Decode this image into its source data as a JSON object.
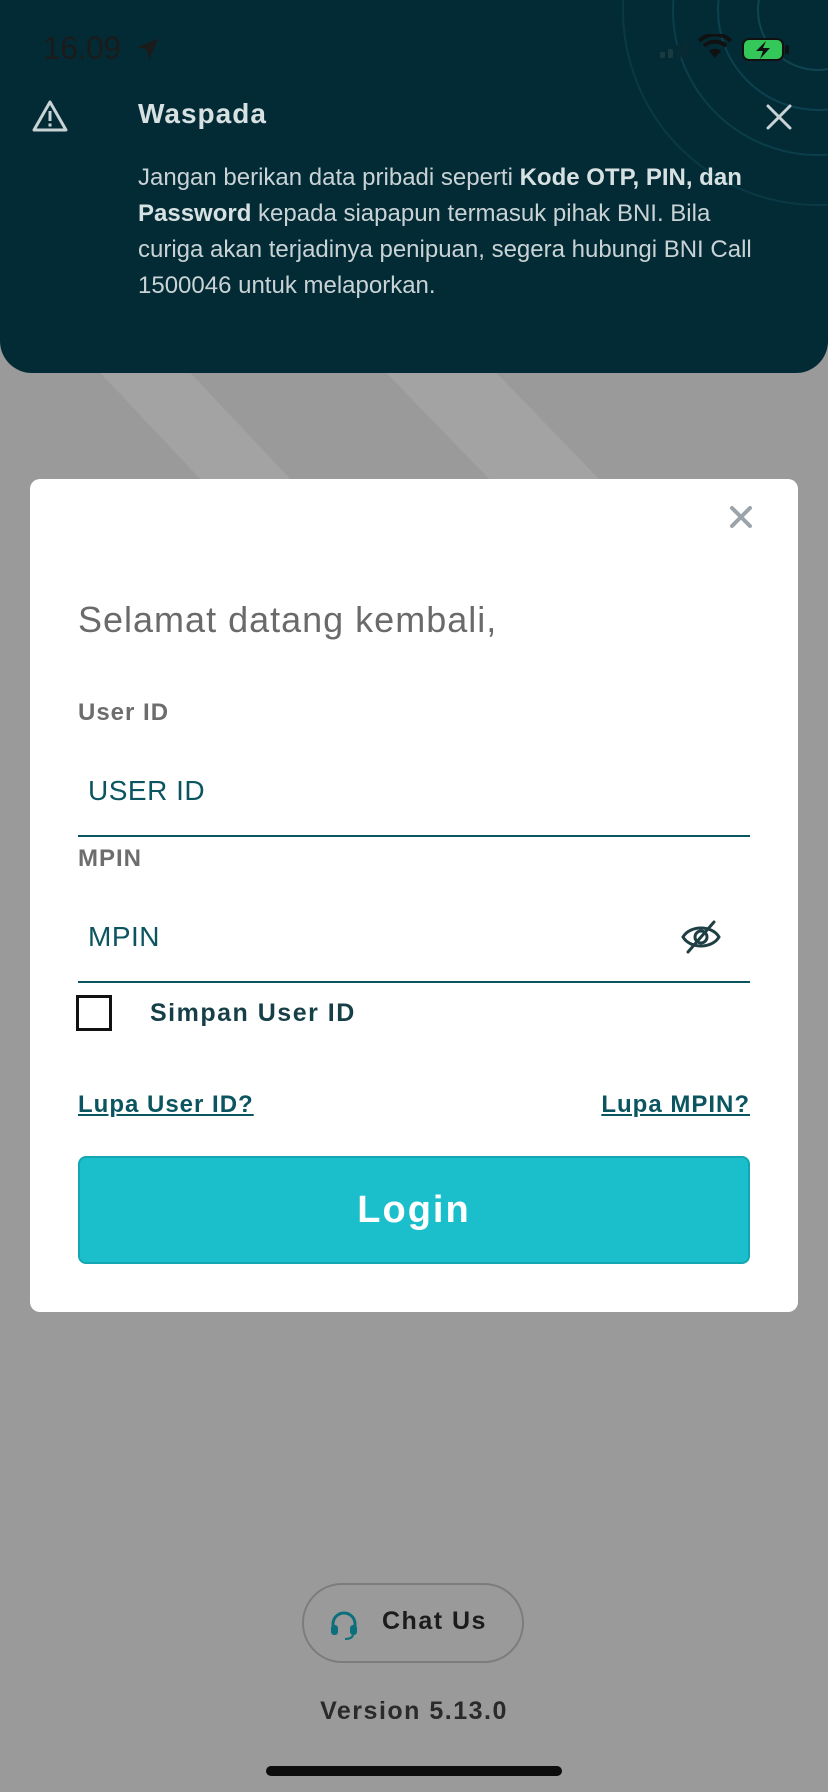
{
  "status_bar": {
    "time": "16.09",
    "icons": [
      "location-arrow-icon",
      "cellular-signal-icon",
      "wifi-icon",
      "battery-charging-icon"
    ]
  },
  "warning_banner": {
    "icon": "warning-triangle-icon",
    "title": "Waspada",
    "text_part1": "Jangan berikan data pribadi seperti ",
    "text_bold": "Kode OTP, PIN, dan Password",
    "text_part2": " kepada siapapun termasuk pihak BNI. Bila curiga akan terjadinya penipuan, segera hubungi BNI Call 1500046 untuk melaporkan."
  },
  "login_card": {
    "welcome": "Selamat datang kembali,",
    "user_id_label": "User ID",
    "user_id_placeholder": "USER ID",
    "mpin_label": "MPIN",
    "mpin_placeholder": "MPIN",
    "remember_label": "Simpan User ID",
    "remember_checked": false,
    "forgot_user_id": "Lupa User ID?",
    "forgot_mpin": "Lupa MPIN?",
    "login_button": "Login"
  },
  "footer": {
    "chat_label": "Chat Us",
    "version": "Version 5.13.0"
  },
  "colors": {
    "banner_bg": "#032b36",
    "accent_teal": "#0b5560",
    "login_button": "#1bbfcc",
    "overlay_bg": "#9a9a9a"
  }
}
